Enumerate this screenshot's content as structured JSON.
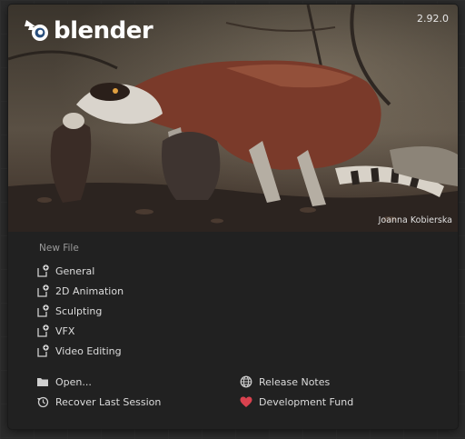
{
  "app": {
    "name": "blender",
    "version": "2.92.0"
  },
  "splash": {
    "credit": "Joanna Kobierska"
  },
  "new_file": {
    "title": "New File",
    "items": [
      {
        "label": "General",
        "icon": "file-new-icon"
      },
      {
        "label": "2D Animation",
        "icon": "file-new-icon"
      },
      {
        "label": "Sculpting",
        "icon": "file-new-icon"
      },
      {
        "label": "VFX",
        "icon": "file-new-icon"
      },
      {
        "label": "Video Editing",
        "icon": "file-new-icon"
      }
    ]
  },
  "actions": {
    "open": {
      "label": "Open...",
      "icon": "folder-icon"
    },
    "recover": {
      "label": "Recover Last Session",
      "icon": "recover-icon"
    },
    "release_notes": {
      "label": "Release Notes",
      "icon": "globe-icon"
    },
    "dev_fund": {
      "label": "Development Fund",
      "icon": "heart-icon"
    }
  },
  "colors": {
    "accent": "#e8767a",
    "panel": "#212121",
    "text": "#dcdcdc"
  }
}
